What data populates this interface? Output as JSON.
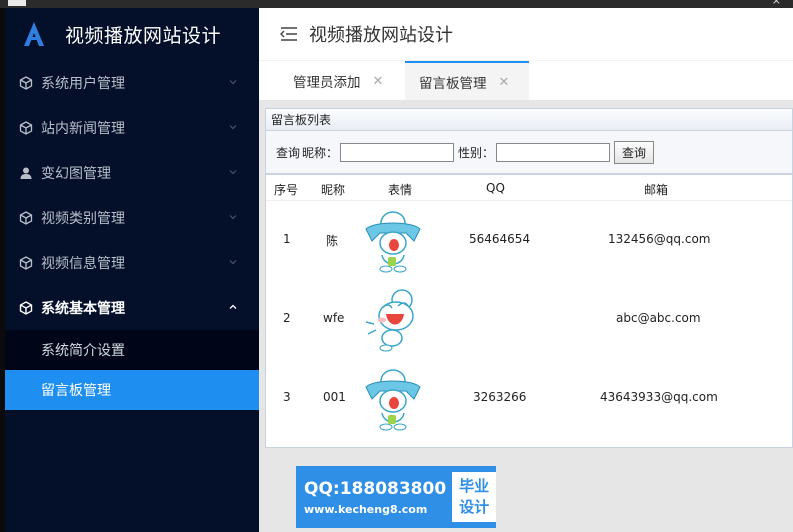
{
  "brand": {
    "title": "视频播放网站设计",
    "logo": "A"
  },
  "header": {
    "title": "视频播放网站设计"
  },
  "menu": {
    "items": [
      {
        "label": "系统用户管理",
        "icon": "cube-icon"
      },
      {
        "label": "站内新闻管理",
        "icon": "cube-icon"
      },
      {
        "label": "变幻图管理",
        "icon": "user-icon"
      },
      {
        "label": "视频类别管理",
        "icon": "cube-icon"
      },
      {
        "label": "视频信息管理",
        "icon": "cube-icon"
      },
      {
        "label": "系统基本管理",
        "icon": "cube-icon"
      }
    ],
    "sub_items": [
      {
        "label": "系统简介设置"
      },
      {
        "label": "留言板管理"
      }
    ]
  },
  "tabs": [
    {
      "label": "管理员添加",
      "close": "✕"
    },
    {
      "label": "留言板管理",
      "close": "✕"
    }
  ],
  "panel": {
    "title": "留言板列表"
  },
  "search": {
    "query_label": "查询",
    "nickname_label": "昵称：",
    "nickname_value": "",
    "gender_label": "性别：",
    "gender_value": "",
    "button": "查询"
  },
  "table": {
    "headers": [
      "序号",
      "昵称",
      "表情",
      "QQ",
      "邮箱"
    ],
    "rows": [
      {
        "no": "1",
        "nickname": "陈",
        "emoji": "crying-face-icon",
        "qq": "56464654",
        "email": "132456@qq.com"
      },
      {
        "no": "2",
        "nickname": "wfe",
        "emoji": "laughing-face-icon",
        "qq": "",
        "email": "abc@abc.com"
      },
      {
        "no": "3",
        "nickname": "001",
        "emoji": "crying-face-icon",
        "qq": "3263266",
        "email": "43643933@qq.com"
      }
    ]
  },
  "watermark": {
    "qq": "QQ:188083800",
    "url": "www.kecheng8.com",
    "box_line1": "毕业",
    "box_line2": "设计"
  },
  "colors": {
    "sidebar": "#04102a",
    "accent": "#1e8ef0",
    "watermark": "#2f8fe6"
  }
}
